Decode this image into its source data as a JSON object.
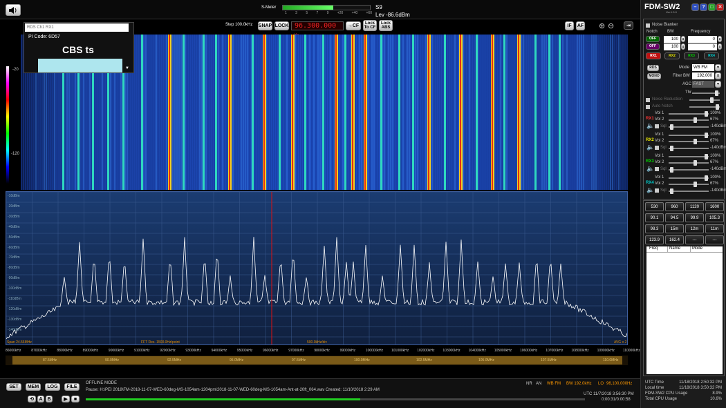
{
  "top": {
    "smeter_label": "S-Meter",
    "smeter_value": "S9",
    "smeter_level": "Lev -86.6dBm",
    "scale": [
      "1",
      "3",
      "5",
      "7",
      "9",
      "+20",
      "+40",
      "+60"
    ],
    "step": "Step 100.0kHz",
    "snap": "SNAP",
    "lock": "LOCK",
    "frequency": "96.300.000",
    "freq_unit": "Hz",
    "cf": "CF",
    "lock_to_cf": [
      "Lock",
      "To CF"
    ],
    "lock_abs": [
      "Lock",
      "ABS"
    ],
    "if": "IF",
    "af": "AF"
  },
  "rds": {
    "header": "RDS Ch1 RX1",
    "pi_code": "PI Code: 6D57",
    "ps": "CBS ts"
  },
  "waterfall": {
    "scale_top": "-20",
    "scale_bottom": "-120"
  },
  "spectrum": {
    "db_labels": [
      "-10dBm",
      "-20dBm",
      "-30dBm",
      "-40dBm",
      "-50dBm",
      "-60dBm",
      "-70dBm",
      "-80dBm",
      "-90dBm",
      "-100dBm",
      "-110dBm",
      "-120dBm",
      "-130dBm",
      "-140dBm"
    ],
    "span": "Span 24.56MHz",
    "fft_res": "FFT Res. 1500.0Hz/point",
    "div": "500.0kHz/div",
    "avg": "AVG x 2",
    "freq_labels": [
      "86000kHz",
      "87000kHz",
      "88000kHz",
      "89000kHz",
      "90000kHz",
      "91000kHz",
      "92000kHz",
      "93000kHz",
      "94000kHz",
      "95000kHz",
      "96000kHz",
      "97000kHz",
      "98000kHz",
      "99000kHz",
      "100000kHz",
      "101000kHz",
      "102000kHz",
      "103000kHz",
      "104000kHz",
      "105000kHz",
      "106000kHz",
      "107000kHz",
      "108000kHz",
      "109000kHz",
      "110000kHz"
    ],
    "band_labels": [
      "87.5MHz",
      "90.0MHz",
      "92.5MHz",
      "95.0MHz",
      "97.5MHz",
      "100.0MHz",
      "102.5MHz",
      "105.0MHz",
      "107.5MHz",
      "110.0MHz"
    ]
  },
  "bottom": {
    "buttons": [
      "SET",
      "MEM",
      "LOG",
      "FILE"
    ],
    "small_a": "A",
    "small_b": "B",
    "mode": "OFFLINE MODE",
    "pause": "Pause: H:\\PEI 2018\\FM-2018-11-07-WED-60deg-MS-1054am-1204pm\\2018-11-07-WED-60deg-MS-1054am-Ant-at-20ft_064.wav Created: 11/10/2018 2:29 AM",
    "nr": "NR",
    "an": "AN",
    "wbfm": "WB FM",
    "bw": "BW 192.0kHz",
    "lo": "LO",
    "lo_val": "96,100,000Hz",
    "utc": "UTC 11/7/2018 3:56:30 PM",
    "time": "0:00:31/0:00:58"
  },
  "right": {
    "title": "FDM-SW2",
    "version": "Ver.1.0.0",
    "noise_blanker": "Noise Blanker",
    "notch": "Notch",
    "bw": "BW",
    "frequency": "Frequency",
    "notch_rows": [
      {
        "state": "OFF",
        "bw": "100",
        "freq": "0"
      },
      {
        "state": "OFF",
        "bw": "100",
        "freq": "0"
      }
    ],
    "rx_buttons": [
      "RX1",
      "RX2",
      "RX3",
      "RX4"
    ],
    "rds_btn": "RDS",
    "mono_btn": "MONO",
    "mode_label": "Mode",
    "mode_value": "WB FM",
    "filter_label": "Filter BW",
    "filter_value": "192,000",
    "agc_label": "AGC",
    "agc_value": "FAST",
    "thr_label": "Thr",
    "noise_reduction": "Noise Reduction",
    "auto_notch": "Auto Notch",
    "rx": [
      {
        "name": "RX1",
        "vol1": "Vol 1",
        "v1": "100%",
        "vol2": "Vol 2",
        "v2": "67%",
        "sql": "Sql",
        "s": "-140dBm"
      },
      {
        "name": "RX2",
        "vol1": "Vol 1",
        "v1": "100%",
        "vol2": "Vol 2",
        "v2": "67%",
        "sql": "Sql",
        "s": "-140dBm"
      },
      {
        "name": "RX3",
        "vol1": "Vol 1",
        "v1": "100%",
        "vol2": "Vol 2",
        "v2": "67%",
        "sql": "Sql",
        "s": "-140dBm"
      },
      {
        "name": "RX4",
        "vol1": "Vol 1",
        "v1": "100%",
        "vol2": "Vol 2",
        "v2": "67%",
        "sql": "Sql",
        "s": "-140dBm"
      }
    ],
    "memory": [
      "530",
      "960",
      "1120",
      "1600",
      "90.1",
      "94.5",
      "99.9",
      "105.3",
      "98.3",
      "15m",
      "12m",
      "11m",
      "123.9",
      "162.4",
      "---",
      "---"
    ],
    "table_headers": [
      "Freq",
      "Name",
      "Mode"
    ],
    "status": [
      {
        "k": "UTC Time",
        "v": "11/18/2018 2:50:32 PM"
      },
      {
        "k": "Local time",
        "v": "11/18/2018 3:50:32 PM"
      },
      {
        "k": "FDM-SW2 CPU Usage",
        "v": "8.9%"
      },
      {
        "k": "Total CPU Usage",
        "v": "10.6%"
      }
    ]
  }
}
